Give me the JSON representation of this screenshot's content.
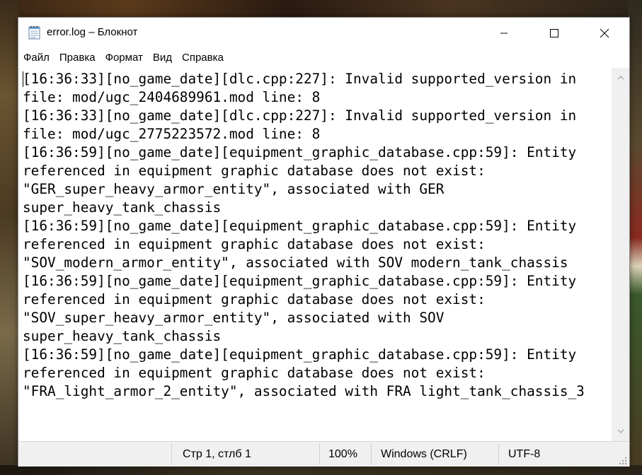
{
  "window": {
    "title": "error.log – Блокнот",
    "icon": "notepad-icon"
  },
  "menu": {
    "items": [
      "Файл",
      "Правка",
      "Формат",
      "Вид",
      "Справка"
    ]
  },
  "editor": {
    "lines": [
      "[16:36:33][no_game_date][dlc.cpp:227]: Invalid supported_version in",
      "file: mod/ugc_2404689961.mod line: 8",
      "[16:36:33][no_game_date][dlc.cpp:227]: Invalid supported_version in",
      "file: mod/ugc_2775223572.mod line: 8",
      "[16:36:59][no_game_date][equipment_graphic_database.cpp:59]: Entity",
      "referenced in equipment graphic database does not exist:",
      "\"GER_super_heavy_armor_entity\", associated with GER",
      "super_heavy_tank_chassis",
      "[16:36:59][no_game_date][equipment_graphic_database.cpp:59]: Entity",
      "referenced in equipment graphic database does not exist:",
      "\"SOV_modern_armor_entity\", associated with SOV modern_tank_chassis",
      "[16:36:59][no_game_date][equipment_graphic_database.cpp:59]: Entity",
      "referenced in equipment graphic database does not exist:",
      "\"SOV_super_heavy_armor_entity\", associated with SOV",
      "super_heavy_tank_chassis",
      "[16:36:59][no_game_date][equipment_graphic_database.cpp:59]: Entity",
      "referenced in equipment graphic database does not exist:",
      "\"FRA_light_armor_2_entity\", associated with FRA light_tank_chassis_3"
    ]
  },
  "status": {
    "position": "Стр 1, стлб 1",
    "zoom": "100%",
    "line_ending": "Windows (CRLF)",
    "encoding": "UTF-8"
  },
  "colors": {
    "window_bg": "#ffffff",
    "statusbar_bg": "#f0f0f0",
    "text": "#000000"
  }
}
